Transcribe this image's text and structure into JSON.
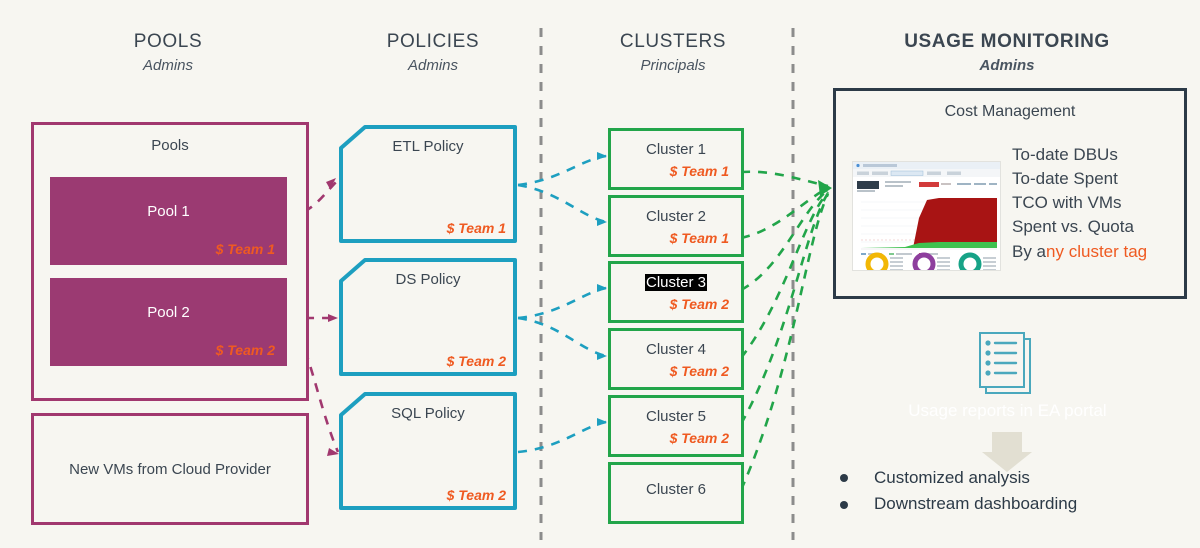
{
  "columns": [
    {
      "title": "POOLS",
      "subtitle": "Admins",
      "bold": false
    },
    {
      "title": "POLICIES",
      "subtitle": "Admins",
      "bold": false
    },
    {
      "title": "CLUSTERS",
      "subtitle": "Principals",
      "bold": false
    },
    {
      "title": "USAGE MONITORING",
      "subtitle": "Admins",
      "bold": true
    }
  ],
  "pools": {
    "group_label": "Pools",
    "items": [
      {
        "name": "Pool 1",
        "team": "$ Team 1"
      },
      {
        "name": "Pool 2",
        "team": "$ Team 2"
      }
    ],
    "vm_box_label": "New VMs from Cloud Provider"
  },
  "policies": [
    {
      "name": "ETL Policy",
      "team": "$ Team 1"
    },
    {
      "name": "DS Policy",
      "team": "$ Team 2"
    },
    {
      "name": "SQL Policy",
      "team": "$ Team 2"
    }
  ],
  "clusters": [
    {
      "name": "Cluster 1",
      "team": "$ Team 1",
      "highlighted": false
    },
    {
      "name": "Cluster 2",
      "team": "$ Team 1",
      "highlighted": false
    },
    {
      "name": "Cluster 3",
      "team": "$ Team 2",
      "highlighted": true
    },
    {
      "name": "Cluster 4",
      "team": "$ Team 2",
      "highlighted": false
    },
    {
      "name": "Cluster 5",
      "team": "$ Team 2",
      "highlighted": false
    },
    {
      "name": "Cluster 6",
      "team": "",
      "highlighted": false
    }
  ],
  "monitoring": {
    "panel_title": "Cost Management",
    "metrics_line_1": "To-date DBUs",
    "metrics_line_2": "To-date Spent",
    "metrics_line_3": "TCO with VMs",
    "metrics_line_4": "Spent vs. Quota",
    "metrics_line_5_prefix": "By a",
    "metrics_line_5_accent": "ny cluster tag",
    "reports_caption": "Usage reports in EA portal",
    "bullets": [
      "Customized analysis",
      "Downstream dashboarding"
    ]
  },
  "colors": {
    "background": "#f7f6f1",
    "pool_fill": "#9b3a72",
    "pool_border": "#a1386f",
    "policy_border": "#1d9fc0",
    "cluster_border": "#22a54a",
    "monitor_border": "#2c3a47",
    "accent_orange": "#ef5a21",
    "divider_gray": "#8c8c8c"
  }
}
